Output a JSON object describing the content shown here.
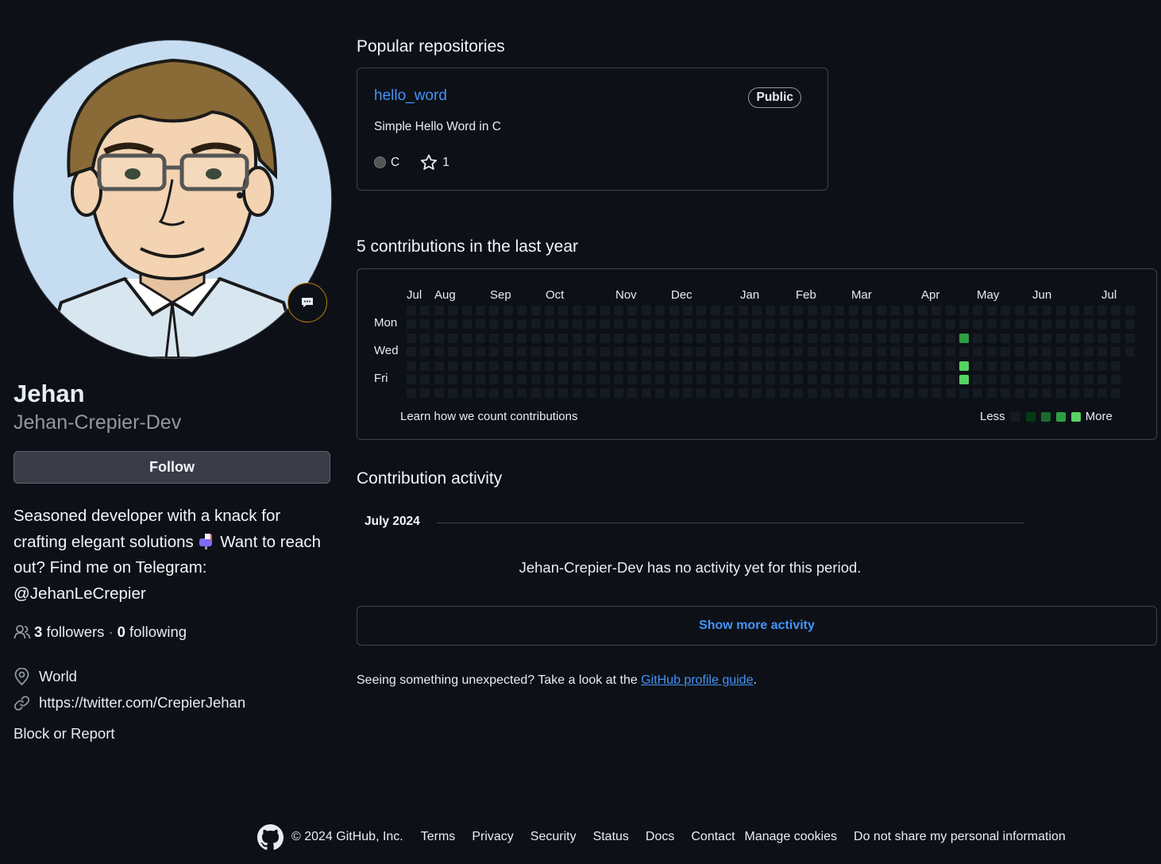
{
  "profile": {
    "name": "Jehan",
    "login": "Jehan-Crepier-Dev",
    "follow_label": "Follow",
    "bio_part1": "Seasoned developer with a knack for crafting elegant solutions",
    "bio_emoji": "mailbox-with-mail-icon",
    "bio_part2": "Want to reach out? Find me on Telegram: @JehanLeCrepier",
    "followers_count": "3",
    "followers_label": "followers",
    "separator": "·",
    "following_count": "0",
    "following_label": "following",
    "location": "World",
    "website": "https://twitter.com/CrepierJehan",
    "block_label": "Block or Report"
  },
  "popular": {
    "heading": "Popular repositories",
    "repos": [
      {
        "name": "hello_word",
        "visibility": "Public",
        "description": "Simple Hello Word in C",
        "language": "C",
        "language_color": "#555555",
        "stars": "1"
      }
    ]
  },
  "contributions": {
    "heading": "5 contributions in the last year",
    "months": [
      "Jul",
      "Aug",
      "Sep",
      "Oct",
      "Nov",
      "Dec",
      "Jan",
      "Feb",
      "Mar",
      "Apr",
      "May",
      "Jun",
      "Jul"
    ],
    "days": [
      "Mon",
      "Wed",
      "Fri"
    ],
    "learn_label": "Learn how we count contributions",
    "legend_less": "Less",
    "legend_more": "More",
    "levels": [
      "#151b23",
      "#033a16",
      "#196c2e",
      "#2ea043",
      "#56d364"
    ],
    "active_cells": [
      {
        "week": 40,
        "day": 2,
        "level": 3
      },
      {
        "week": 40,
        "day": 4,
        "level": 4
      },
      {
        "week": 40,
        "day": 5,
        "level": 4
      }
    ]
  },
  "activity": {
    "heading": "Contribution activity",
    "period": "July 2024",
    "empty_text": "Jehan-Crepier-Dev has no activity yet for this period.",
    "show_more_label": "Show more activity",
    "guide_prefix": "Seeing something unexpected? Take a look at the",
    "guide_link": "GitHub profile guide",
    "guide_suffix": "."
  },
  "footer": {
    "copyright": "© 2024 GitHub, Inc.",
    "links": [
      "Terms",
      "Privacy",
      "Security",
      "Status",
      "Docs",
      "Contact",
      "Manage cookies",
      "Do not share my personal information"
    ]
  }
}
